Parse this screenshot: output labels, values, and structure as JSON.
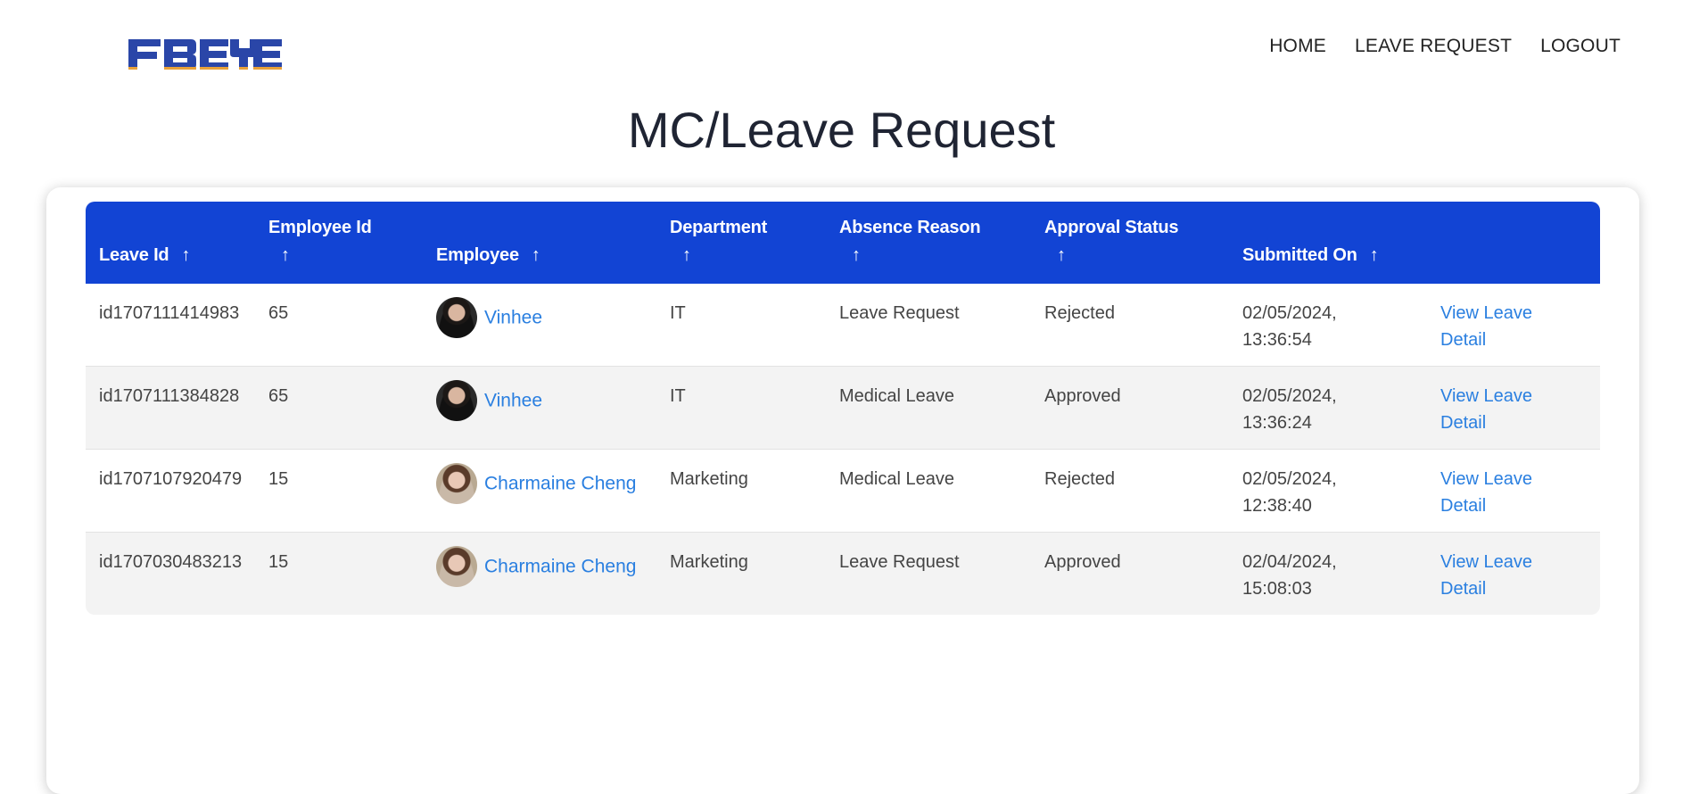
{
  "nav": {
    "logo_text": "FBEYE",
    "links": [
      "HOME",
      "LEAVE REQUEST",
      "LOGOUT"
    ]
  },
  "page_title": "MC/Leave Request",
  "table": {
    "headers": {
      "leave_id": "Leave Id",
      "employee_id": "Employee Id",
      "employee": "Employee",
      "department": "Department",
      "absence_reason": "Absence Reason",
      "approval_status": "Approval Status",
      "submitted_on": "Submitted On"
    },
    "sort_arrow": "↑",
    "rows": [
      {
        "leave_id": "id1707111414983",
        "employee_id": "65",
        "employee_name": "Vinhee",
        "department": "IT",
        "absence_reason": "Leave Request",
        "approval_status": "Rejected",
        "submitted_date": "02/05/2024,",
        "submitted_time": "13:36:54",
        "action_line1": "View Leave",
        "action_line2": "Detail"
      },
      {
        "leave_id": "id1707111384828",
        "employee_id": "65",
        "employee_name": "Vinhee",
        "department": "IT",
        "absence_reason": "Medical Leave",
        "approval_status": "Approved",
        "submitted_date": "02/05/2024,",
        "submitted_time": "13:36:24",
        "action_line1": "View Leave",
        "action_line2": "Detail"
      },
      {
        "leave_id": "id1707107920479",
        "employee_id": "15",
        "employee_name": "Charmaine Cheng",
        "department": "Marketing",
        "absence_reason": "Medical Leave",
        "approval_status": "Rejected",
        "submitted_date": "02/05/2024,",
        "submitted_time": "12:38:40",
        "action_line1": "View Leave",
        "action_line2": "Detail"
      },
      {
        "leave_id": "id1707030483213",
        "employee_id": "15",
        "employee_name": "Charmaine Cheng",
        "department": "Marketing",
        "absence_reason": "Leave Request",
        "approval_status": "Approved",
        "submitted_date": "02/04/2024,",
        "submitted_time": "15:08:03",
        "action_line1": "View Leave",
        "action_line2": "Detail"
      }
    ]
  },
  "colors": {
    "header_bg": "#1244d4",
    "link": "#2a7fe0",
    "logo_primary": "#2a46a8",
    "logo_accent": "#e8a13a"
  }
}
